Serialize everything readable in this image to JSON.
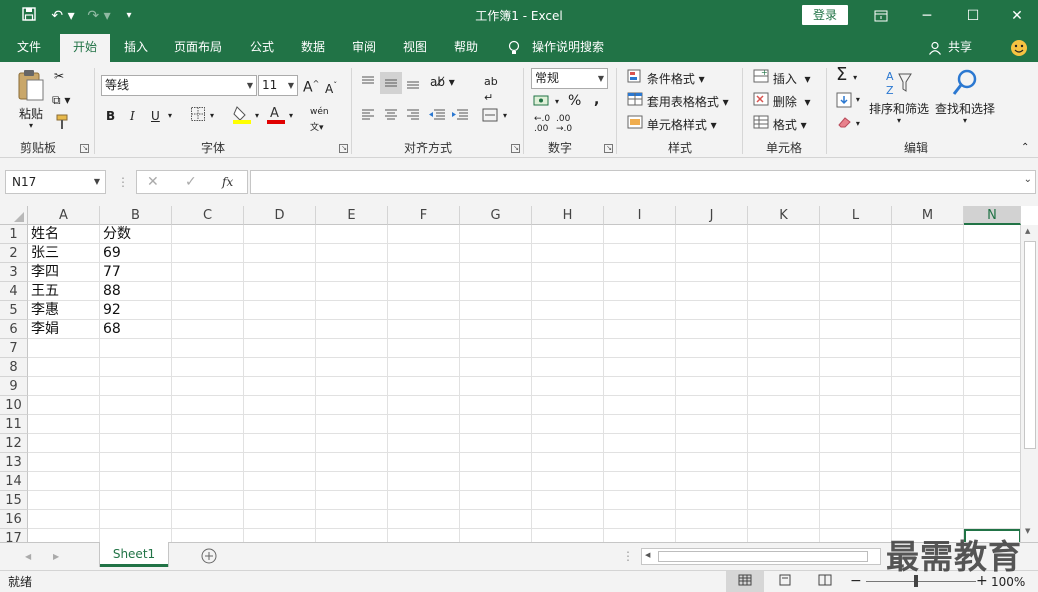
{
  "titlebar": {
    "title": "工作簿1  -  Excel",
    "login": "登录",
    "save_icon": "save-icon",
    "undo_icon": "undo-icon",
    "redo_icon": "redo-icon"
  },
  "tabs": [
    "文件",
    "开始",
    "插入",
    "页面布局",
    "公式",
    "数据",
    "审阅",
    "视图",
    "帮助"
  ],
  "tell_me": "操作说明搜索",
  "share": "共享",
  "ribbon": {
    "clipboard": {
      "label": "剪贴板",
      "paste": "粘贴"
    },
    "font": {
      "label": "字体",
      "name": "等线",
      "size": "11",
      "bold": "B",
      "italic": "I",
      "underline": "U"
    },
    "alignment": {
      "label": "对齐方式"
    },
    "number": {
      "label": "数字",
      "format": "常规"
    },
    "styles": {
      "label": "样式",
      "conditional": "条件格式",
      "table": "套用表格格式",
      "cell_styles": "单元格样式"
    },
    "cells": {
      "label": "单元格",
      "insert": "插入",
      "delete": "删除",
      "format": "格式"
    },
    "editing": {
      "label": "编辑",
      "sort_filter": "排序和筛选",
      "find_select": "查找和选择"
    }
  },
  "formula_bar": {
    "name_box": "N17",
    "fx": "fx",
    "value": ""
  },
  "columns": [
    "A",
    "B",
    "C",
    "D",
    "E",
    "F",
    "G",
    "H",
    "I",
    "J",
    "K",
    "L",
    "M",
    "N"
  ],
  "selected_column": "N",
  "rows": [
    "1",
    "2",
    "3",
    "4",
    "5",
    "6",
    "7",
    "8",
    "9",
    "10",
    "11",
    "12",
    "13",
    "14",
    "15",
    "16",
    "17"
  ],
  "cells": [
    [
      "姓名",
      "分数"
    ],
    [
      "张三",
      "69"
    ],
    [
      "李四",
      "77"
    ],
    [
      "王五",
      "88"
    ],
    [
      "李惠",
      "92"
    ],
    [
      "李娟",
      "68"
    ]
  ],
  "sheets": [
    "Sheet1"
  ],
  "status": {
    "ready": "就绪",
    "zoom": "100%"
  },
  "watermark": "最需教育",
  "colors": {
    "excel_green": "#217346",
    "ribbon_bg": "#f3f3f3",
    "grid_line": "#e1e1e1"
  }
}
